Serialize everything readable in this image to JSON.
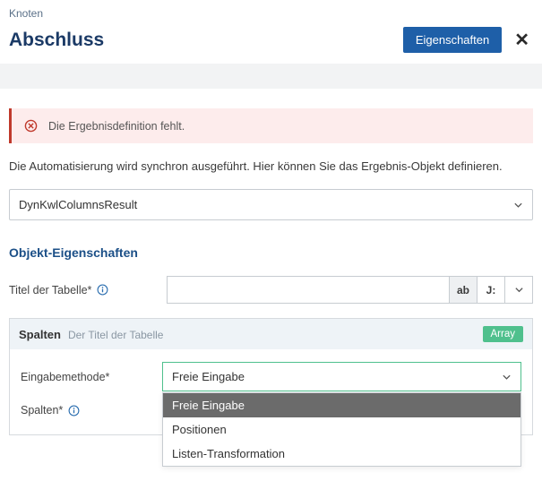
{
  "breadcrumb": "Knoten",
  "title": "Abschluss",
  "header": {
    "properties_button": "Eigenschaften"
  },
  "alert": {
    "message": "Die Ergebnisdefinition fehlt."
  },
  "description": "Die Automatisierung wird synchron ausgeführt. Hier können Sie das Ergebnis-Objekt definieren.",
  "result_type": {
    "value": "DynKwlColumnsResult"
  },
  "object_properties": {
    "heading": "Objekt-Eigenschaften",
    "table_title": {
      "label": "Titel der Tabelle*",
      "value": "",
      "btn_ab": "ab",
      "btn_js": "J:"
    }
  },
  "columns_panel": {
    "title": "Spalten",
    "subtitle": "Der Titel der Tabelle",
    "tag": "Array",
    "input_method": {
      "label": "Eingabemethode*",
      "selected": "Freie Eingabe",
      "options": [
        "Freie Eingabe",
        "Positionen",
        "Listen-Transformation"
      ]
    },
    "columns_field": {
      "label": "Spalten*"
    }
  }
}
